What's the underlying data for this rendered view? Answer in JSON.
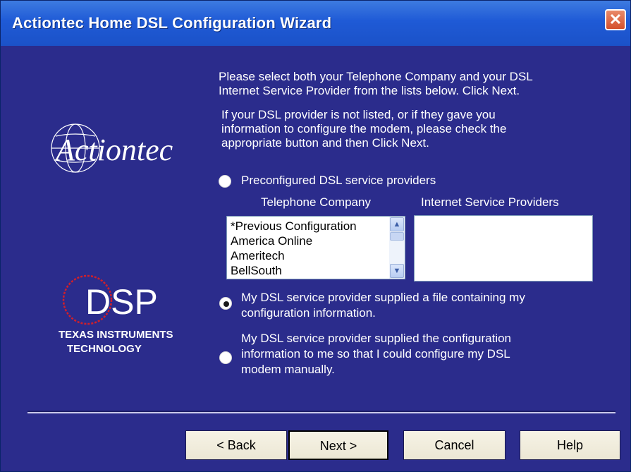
{
  "window": {
    "title": "Actiontec Home DSL Configuration Wizard",
    "close_glyph": "✕"
  },
  "instructions": {
    "p1_line1": "Please select both your Telephone Company and your DSL",
    "p1_line2": "Internet Service Provider from the lists below. Click Next.",
    "p2_line1": "If your DSL provider is not listed, or if they gave you",
    "p2_line2": "information to configure the modem, please check the",
    "p2_line3": "appropriate button and then Click Next."
  },
  "logos": {
    "actiontec": "Actiontec",
    "dsp": "DSP",
    "ti_line1": "TEXAS INSTRUMENTS",
    "ti_line2": "TECHNOLOGY"
  },
  "options": {
    "preconfigured": {
      "label": "Preconfigured DSL service providers",
      "selected": false
    },
    "file_line1": "My DSL service provider supplied a file containing my",
    "file_line2": "configuration information.",
    "file_selected": true,
    "manual_line1": "My DSL service provider supplied the configuration",
    "manual_line2": "information to me so that I could configure my DSL",
    "manual_line3": "modem manually.",
    "manual_selected": false
  },
  "lists": {
    "telephone_header": "Telephone Company",
    "isp_header": "Internet Service Providers",
    "telephone_items": [
      "*Previous Configuration",
      "America Online",
      "Ameritech",
      "BellSouth"
    ],
    "isp_items": []
  },
  "buttons": {
    "back": "< Back",
    "next": "Next >",
    "cancel": "Cancel",
    "help": "Help"
  },
  "colors": {
    "client_bg": "#2b2c8c",
    "title_bar": "#1f5ad6",
    "close_red": "#d4502c"
  }
}
